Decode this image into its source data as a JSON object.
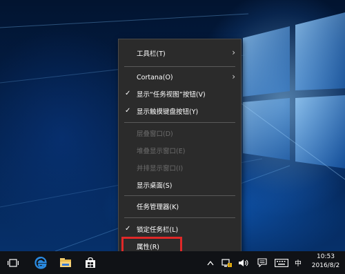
{
  "context_menu": {
    "items": [
      {
        "label": "工具栏(T)"
      },
      {
        "label": "Cortana(O)"
      },
      {
        "label": "显示“任务视图”按钮(V)"
      },
      {
        "label": "显示触摸键盘按钮(Y)"
      },
      {
        "label": "层叠窗口(D)"
      },
      {
        "label": "堆叠显示窗口(E)"
      },
      {
        "label": "并排显示窗口(I)"
      },
      {
        "label": "显示桌面(S)"
      },
      {
        "label": "任务管理器(K)"
      },
      {
        "label": "锁定任务栏(L)"
      },
      {
        "label": "属性(R)"
      }
    ],
    "highlight_color": "#e02828"
  },
  "taskbar": {
    "ime_label": "中",
    "clock_time": "10:53",
    "clock_date": "2016/8/2",
    "icons": [
      "task-view-icon",
      "edge-icon",
      "file-explorer-icon",
      "store-icon"
    ],
    "tray_icons": [
      "show-hidden-icons-chevron-icon",
      "network-icon",
      "volume-icon",
      "action-center-icon",
      "touch-keyboard-icon"
    ]
  },
  "colors": {
    "menu_bg": "#2b2b2b",
    "taskbar_bg": "#101216",
    "edge_blue": "#2a8ae0"
  }
}
